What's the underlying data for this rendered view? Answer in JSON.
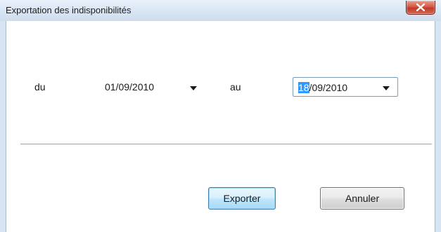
{
  "window": {
    "title": "Exportation des indisponibilités",
    "close_icon": "close-x-icon"
  },
  "form": {
    "from_label": "du",
    "from_date": "01/09/2010",
    "to_label": "au",
    "to_date_selected_part": "18",
    "to_date_rest": "/09/2010"
  },
  "buttons": {
    "export_label": "Exporter",
    "cancel_label": "Annuler"
  },
  "colors": {
    "selection": "#3399ff",
    "close_button": "#c0392b",
    "default_button_border": "#3c7fb1"
  }
}
